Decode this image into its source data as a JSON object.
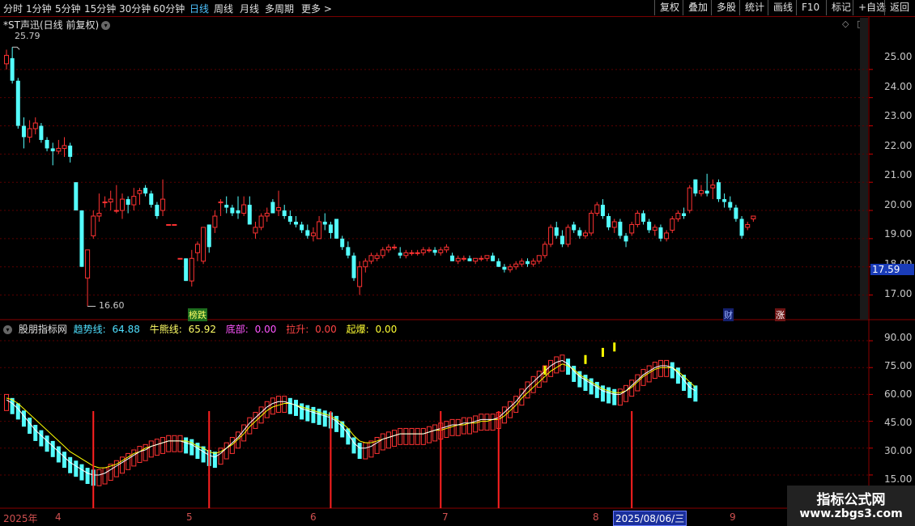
{
  "toolbar": {
    "periods": [
      "分时",
      "1分钟",
      "5分钟",
      "15分钟",
      "30分钟",
      "60分钟",
      "日线",
      "周线",
      "月线",
      "多周期",
      "更多"
    ],
    "active_period": "日线",
    "more_arrow": ">",
    "right_buttons": [
      "复权",
      "叠加",
      "多股",
      "统计",
      "画线",
      "F10",
      "+自选",
      "返回"
    ],
    "right_button_marks": [
      "",
      "",
      "",
      "",
      "",
      "",
      "",
      ""
    ]
  },
  "stock": {
    "title": "*ST声迅(日线 前复权)",
    "icon": "chevron-down-icon"
  },
  "panel_icons": [
    "◇",
    "□"
  ],
  "price_axis": {
    "ticks": [
      "25.00",
      "24.00",
      "23.00",
      "22.00",
      "21.00",
      "20.00",
      "19.00",
      "18.00",
      "17.00"
    ],
    "current": "17.59"
  },
  "annotations": {
    "high": "25.79",
    "low": "16.60"
  },
  "events": {
    "list_label": "榜跌",
    "fin_label": "财",
    "up_label": "涨"
  },
  "indicator": {
    "name": "股朋指标网",
    "trend_label": "趋势线:",
    "trend_value": "64.88",
    "bull_label": "牛熊线:",
    "bull_value": "65.92",
    "bottom_label": "底部:",
    "bottom_value": "0.00",
    "pull_label": "拉升:",
    "pull_value": "0.00",
    "burst_label": "起爆:",
    "burst_value": "0.00",
    "ticks": [
      "90.00",
      "75.00",
      "60.00",
      "45.00",
      "30.00",
      "15.00"
    ]
  },
  "xaxis": {
    "labels": [
      "2025年",
      "4",
      "5",
      "6",
      "7",
      "8",
      "9"
    ],
    "selected_date": "2025/08/06/三"
  },
  "watermark": {
    "line1": "指标公式网",
    "line2": "www.zbgs3.com"
  },
  "colors": {
    "up": "#ff3232",
    "down": "#54ffff",
    "ma_white": "#ffffff",
    "ma_yellow": "#ffff00",
    "grid": "#5a0000"
  },
  "chart_data": {
    "type": "candlestick",
    "ylim": [
      16.5,
      26.2
    ],
    "highlighted_high": 25.79,
    "highlighted_low": 16.6,
    "ohlc": [
      [
        25.2,
        25.7,
        25.0,
        25.5
      ],
      [
        25.4,
        25.79,
        24.5,
        24.6
      ],
      [
        24.6,
        24.7,
        22.9,
        23.0
      ],
      [
        23.0,
        23.3,
        22.2,
        22.6
      ],
      [
        22.6,
        23.2,
        22.4,
        22.9
      ],
      [
        22.9,
        23.3,
        22.7,
        23.1
      ],
      [
        23.0,
        23.1,
        22.4,
        22.5
      ],
      [
        22.5,
        22.6,
        22.1,
        22.2
      ],
      [
        22.2,
        22.4,
        21.6,
        22.1
      ],
      [
        22.1,
        22.5,
        22.0,
        22.2
      ],
      [
        22.2,
        22.6,
        21.9,
        22.3
      ],
      [
        22.3,
        22.4,
        21.7,
        21.9
      ],
      [
        21.0,
        21.0,
        20.0,
        20.0
      ],
      [
        20.0,
        20.0,
        18.0,
        18.0
      ],
      [
        17.6,
        18.6,
        16.6,
        18.6
      ],
      [
        19.1,
        20.0,
        19.0,
        19.8
      ],
      [
        19.8,
        20.6,
        19.6,
        19.9
      ],
      [
        20.3,
        20.5,
        20.1,
        20.3
      ],
      [
        20.3,
        20.7,
        20.0,
        20.4
      ],
      [
        20.0,
        20.9,
        19.9,
        20.0
      ],
      [
        20.0,
        20.6,
        19.7,
        20.4
      ],
      [
        20.4,
        20.5,
        19.9,
        20.2
      ],
      [
        20.2,
        20.8,
        20.0,
        20.5
      ],
      [
        20.6,
        20.8,
        20.2,
        20.7
      ],
      [
        20.8,
        20.9,
        20.5,
        20.6
      ],
      [
        20.6,
        20.7,
        20.1,
        20.2
      ],
      [
        20.2,
        20.3,
        19.7,
        19.8
      ],
      [
        20.0,
        21.1,
        19.8,
        20.4
      ],
      [
        19.5,
        19.5,
        19.5,
        19.5
      ],
      [
        19.5,
        19.5,
        19.5,
        19.5
      ],
      [
        18.3,
        18.3,
        18.3,
        18.3
      ],
      [
        18.3,
        18.3,
        17.5,
        17.5
      ],
      [
        17.5,
        18.6,
        17.3,
        18.3
      ],
      [
        18.5,
        18.9,
        18.2,
        18.8
      ],
      [
        18.2,
        19.0,
        18.1,
        19.4
      ],
      [
        19.5,
        19.5,
        18.5,
        18.7
      ],
      [
        19.4,
        20.0,
        19.2,
        19.8
      ],
      [
        20.3,
        20.4,
        19.8,
        20.3
      ],
      [
        20.2,
        20.5,
        19.9,
        20.1
      ],
      [
        20.1,
        20.2,
        19.8,
        19.9
      ],
      [
        20.0,
        20.5,
        19.7,
        19.9
      ],
      [
        19.9,
        20.5,
        19.8,
        20.2
      ],
      [
        20.2,
        20.5,
        19.5,
        19.5
      ],
      [
        19.2,
        19.6,
        19.0,
        19.4
      ],
      [
        19.4,
        19.9,
        19.3,
        19.8
      ],
      [
        19.8,
        20.1,
        19.6,
        19.9
      ],
      [
        20.3,
        20.4,
        19.9,
        19.9
      ],
      [
        20.0,
        20.7,
        19.8,
        20.1
      ],
      [
        20.0,
        20.2,
        19.7,
        19.8
      ],
      [
        19.8,
        20.0,
        19.5,
        19.6
      ],
      [
        19.6,
        19.8,
        19.4,
        19.5
      ],
      [
        19.5,
        19.6,
        19.2,
        19.3
      ],
      [
        19.3,
        19.5,
        19.0,
        19.1
      ],
      [
        19.1,
        19.4,
        18.9,
        19.2
      ],
      [
        19.0,
        19.8,
        19.0,
        19.6
      ],
      [
        19.6,
        19.9,
        19.3,
        19.5
      ],
      [
        19.5,
        19.6,
        19.0,
        19.2
      ],
      [
        19.7,
        19.7,
        19.0,
        19.0
      ],
      [
        19.0,
        19.1,
        18.6,
        18.7
      ],
      [
        18.7,
        18.9,
        18.3,
        18.4
      ],
      [
        18.4,
        18.5,
        17.5,
        17.6
      ],
      [
        17.3,
        18.2,
        17.0,
        18.0
      ],
      [
        18.0,
        18.3,
        17.8,
        18.2
      ],
      [
        18.2,
        18.5,
        18.1,
        18.4
      ],
      [
        18.3,
        18.5,
        18.2,
        18.4
      ],
      [
        18.4,
        18.7,
        18.3,
        18.6
      ],
      [
        18.6,
        18.8,
        18.5,
        18.7
      ],
      [
        18.7,
        18.8,
        18.6,
        18.7
      ],
      [
        18.5,
        18.7,
        18.3,
        18.4
      ],
      [
        18.4,
        18.6,
        18.3,
        18.5
      ],
      [
        18.5,
        18.6,
        18.4,
        18.5
      ],
      [
        18.5,
        18.6,
        18.4,
        18.5
      ],
      [
        18.5,
        18.7,
        18.4,
        18.6
      ],
      [
        18.6,
        18.7,
        18.5,
        18.6
      ],
      [
        18.6,
        18.7,
        18.4,
        18.5
      ],
      [
        18.5,
        18.7,
        18.4,
        18.6
      ],
      [
        18.6,
        18.8,
        18.5,
        18.7
      ],
      [
        18.4,
        18.5,
        18.2,
        18.2
      ],
      [
        18.2,
        18.4,
        18.1,
        18.3
      ],
      [
        18.3,
        18.4,
        18.2,
        18.3
      ],
      [
        18.3,
        18.4,
        18.2,
        18.2
      ],
      [
        18.2,
        18.3,
        18.1,
        18.3
      ],
      [
        18.3,
        18.4,
        18.2,
        18.3
      ],
      [
        18.3,
        18.4,
        18.2,
        18.4
      ],
      [
        18.4,
        18.5,
        18.2,
        18.2
      ],
      [
        18.2,
        18.3,
        18.0,
        18.0
      ],
      [
        18.0,
        18.1,
        17.8,
        17.9
      ],
      [
        17.9,
        18.1,
        17.8,
        18.0
      ],
      [
        18.0,
        18.2,
        17.9,
        18.1
      ],
      [
        18.1,
        18.3,
        18.0,
        18.2
      ],
      [
        18.2,
        18.3,
        18.0,
        18.1
      ],
      [
        18.1,
        18.3,
        18.0,
        18.2
      ],
      [
        18.2,
        18.4,
        18.1,
        18.4
      ],
      [
        18.4,
        18.9,
        18.3,
        18.8
      ],
      [
        18.8,
        19.5,
        18.7,
        19.4
      ],
      [
        19.4,
        19.6,
        19.0,
        19.1
      ],
      [
        19.1,
        19.3,
        18.7,
        18.8
      ],
      [
        18.8,
        19.5,
        18.7,
        19.4
      ],
      [
        19.5,
        19.6,
        19.2,
        19.3
      ],
      [
        19.3,
        19.4,
        19.0,
        19.1
      ],
      [
        19.1,
        19.3,
        19.0,
        19.2
      ],
      [
        19.2,
        20.0,
        19.1,
        19.9
      ],
      [
        19.9,
        20.3,
        19.8,
        20.2
      ],
      [
        20.2,
        20.4,
        19.7,
        19.8
      ],
      [
        19.8,
        19.9,
        19.3,
        19.4
      ],
      [
        19.4,
        19.7,
        19.2,
        19.6
      ],
      [
        19.6,
        19.7,
        19.0,
        19.1
      ],
      [
        19.1,
        19.2,
        18.7,
        18.9
      ],
      [
        19.2,
        19.6,
        19.1,
        19.5
      ],
      [
        19.5,
        20.0,
        19.4,
        19.9
      ],
      [
        19.9,
        20.0,
        19.5,
        19.6
      ],
      [
        19.6,
        19.7,
        19.2,
        19.3
      ],
      [
        19.3,
        19.5,
        19.1,
        19.4
      ],
      [
        19.4,
        19.5,
        18.9,
        19.0
      ],
      [
        19.0,
        19.3,
        18.9,
        19.2
      ],
      [
        19.3,
        19.8,
        19.2,
        19.7
      ],
      [
        19.7,
        20.0,
        19.6,
        19.9
      ],
      [
        19.9,
        20.1,
        19.7,
        19.8
      ],
      [
        20.0,
        20.9,
        19.9,
        20.8
      ],
      [
        21.1,
        21.1,
        20.5,
        20.6
      ],
      [
        20.6,
        20.9,
        20.5,
        20.7
      ],
      [
        20.7,
        21.3,
        20.5,
        20.6
      ],
      [
        20.8,
        21.1,
        20.4,
        20.9
      ],
      [
        21.0,
        21.1,
        20.3,
        20.4
      ],
      [
        20.4,
        20.6,
        20.1,
        20.3
      ],
      [
        20.3,
        20.5,
        20.0,
        20.1
      ],
      [
        20.1,
        20.2,
        19.6,
        19.7
      ],
      [
        19.7,
        19.8,
        19.0,
        19.1
      ],
      [
        19.4,
        19.6,
        19.3,
        19.5
      ],
      [
        19.7,
        19.8,
        19.6,
        19.8
      ]
    ]
  },
  "indicator_chart": {
    "type": "bar+line",
    "ylim": [
      10,
      95
    ],
    "trend_line": [
      57,
      55,
      52,
      48,
      44,
      40,
      37,
      34,
      31,
      28,
      25,
      22,
      20,
      18,
      16,
      15,
      15,
      16,
      18,
      20,
      22,
      24,
      26,
      28,
      29,
      31,
      32,
      33,
      34,
      34,
      34,
      33,
      32,
      30,
      28,
      26,
      25,
      27,
      30,
      33,
      36,
      40,
      44,
      47,
      50,
      53,
      55,
      56,
      56,
      55,
      54,
      52,
      51,
      50,
      49,
      48,
      47,
      45,
      42,
      38,
      33,
      30,
      30,
      31,
      33,
      35,
      36,
      37,
      38,
      38,
      38,
      38,
      38,
      39,
      40,
      41,
      42,
      43,
      43,
      44,
      44,
      45,
      46,
      46,
      46,
      47,
      50,
      53,
      56,
      60,
      64,
      67,
      70,
      73,
      76,
      78,
      79,
      77,
      73,
      70,
      68,
      66,
      64,
      62,
      61,
      60,
      60,
      62,
      65,
      68,
      71,
      73,
      75,
      76,
      76,
      75,
      72,
      68,
      64,
      62
    ],
    "bull_line": [
      58,
      57,
      55,
      52,
      49,
      46,
      43,
      40,
      37,
      34,
      31,
      28,
      26,
      24,
      22,
      20,
      19,
      19,
      20,
      21,
      23,
      25,
      27,
      28,
      30,
      31,
      32,
      33,
      34,
      34,
      34,
      34,
      33,
      31,
      30,
      28,
      27,
      28,
      30,
      32,
      35,
      38,
      42,
      45,
      48,
      51,
      53,
      54,
      55,
      55,
      54,
      53,
      52,
      51,
      50,
      49,
      48,
      46,
      44,
      41,
      37,
      34,
      33,
      33,
      34,
      35,
      36,
      37,
      38,
      38,
      38,
      38,
      38,
      39,
      40,
      40,
      41,
      42,
      43,
      43,
      44,
      44,
      45,
      45,
      46,
      46,
      48,
      51,
      54,
      58,
      61,
      64,
      67,
      70,
      73,
      75,
      77,
      76,
      74,
      71,
      69,
      67,
      65,
      63,
      62,
      61,
      61,
      62,
      64,
      67,
      70,
      72,
      74,
      75,
      75,
      75,
      73,
      70,
      67,
      64
    ],
    "hist": [
      57,
      55,
      52,
      48,
      44,
      40,
      37,
      34,
      31,
      28,
      25,
      22,
      20,
      18,
      16,
      15,
      15,
      16,
      18,
      20,
      22,
      24,
      26,
      28,
      29,
      31,
      32,
      33,
      34,
      34,
      34,
      33,
      32,
      30,
      28,
      26,
      25,
      27,
      30,
      33,
      36,
      40,
      44,
      47,
      50,
      53,
      55,
      56,
      56,
      55,
      54,
      52,
      51,
      50,
      49,
      48,
      47,
      45,
      42,
      38,
      33,
      30,
      30,
      31,
      33,
      35,
      36,
      37,
      38,
      38,
      38,
      38,
      38,
      39,
      40,
      41,
      42,
      43,
      43,
      44,
      44,
      45,
      46,
      46,
      46,
      47,
      50,
      53,
      56,
      60,
      64,
      67,
      70,
      73,
      76,
      78,
      79,
      77,
      73,
      70,
      68,
      66,
      64,
      62,
      61,
      60,
      60,
      62,
      65,
      68,
      71,
      73,
      75,
      76,
      76,
      75,
      72,
      68,
      64,
      62
    ],
    "signals": [
      15,
      35,
      56,
      75,
      85,
      108
    ],
    "spikes": [
      [
        93,
        68
      ],
      [
        100,
        74
      ],
      [
        103,
        78
      ],
      [
        105,
        81
      ]
    ]
  }
}
